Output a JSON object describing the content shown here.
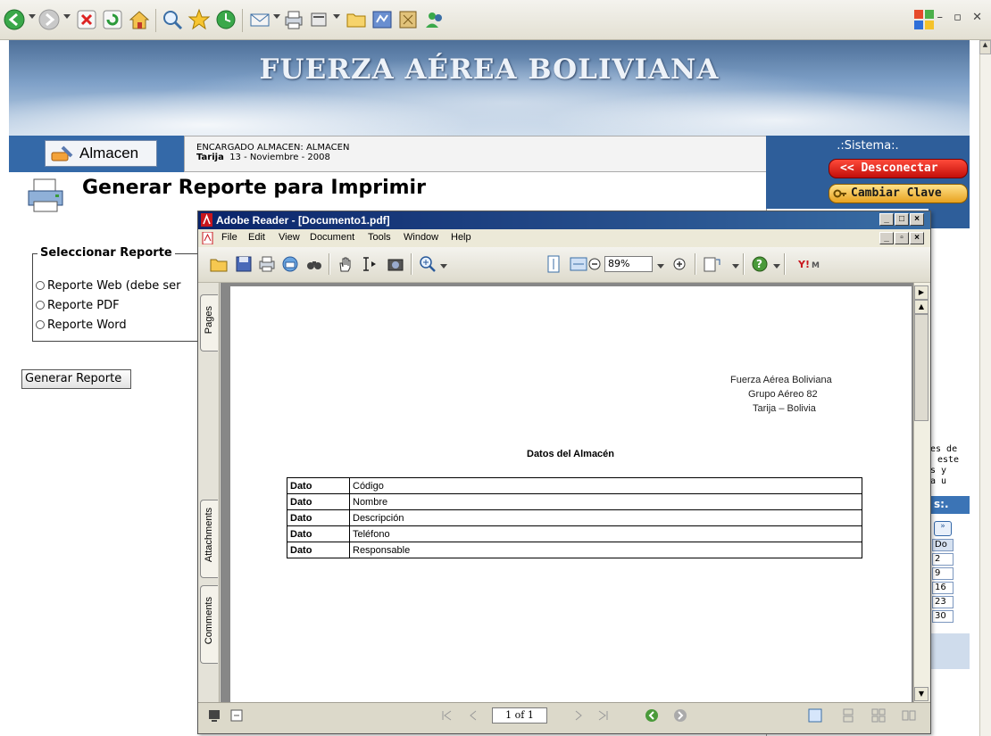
{
  "browser": {
    "toolbar_icons": [
      "back-arrow-icon",
      "forward-arrow-icon",
      "stop-icon",
      "refresh-icon",
      "home-icon",
      "search-icon",
      "favorites-star-icon",
      "history-icon",
      "mail-icon",
      "print-icon",
      "edit-icon",
      "folder-icon",
      "messenger-icon",
      "research-icon",
      "users-icon"
    ],
    "window_controls": "– ▫ ✕"
  },
  "banner": {
    "title": "FUERZA AÉREA BOLIVIANA"
  },
  "header": {
    "almacen_label": "Almacen",
    "encargado": "ENCARGADO ALMACEN: ALMACEN",
    "city": "Tarija",
    "date": "13 - Noviembre - 2008"
  },
  "sistema": {
    "title": ".:Sistema:.",
    "disconnect_label": "<< Desconectar",
    "change_key_label": "Cambiar Clave"
  },
  "right_fragments": {
    "text_lines": [
      "es de",
      "este",
      "s   y",
      "a   u"
    ],
    "section_label": "s:.",
    "cal_next": "»",
    "cal_header": "Do",
    "cal_days": [
      "2",
      "9",
      "16",
      "23",
      "30"
    ]
  },
  "main": {
    "title": "Generar Reporte para Imprimir",
    "fieldset_legend": "Seleccionar Reporte",
    "options": [
      "Reporte Web (debe ser",
      "Reporte PDF",
      "Reporte Word"
    ],
    "generate_button": "Generar Reporte"
  },
  "reader": {
    "title": "Adobe Reader - [Documento1.pdf]",
    "menu": [
      "File",
      "Edit",
      "View",
      "Document",
      "Tools",
      "Window",
      "Help"
    ],
    "zoom": "89%",
    "side_tabs": [
      "Pages",
      "Attachments",
      "Comments"
    ],
    "page_indicator": "1 of 1",
    "document": {
      "header_lines": [
        "Fuerza Aérea Boliviana",
        "Grupo Aéreo 82",
        "Tarija – Bolivia"
      ],
      "section_title": "Datos del Almacén",
      "rows": [
        {
          "label": "Dato",
          "value": "Código"
        },
        {
          "label": "Dato",
          "value": "Nombre"
        },
        {
          "label": "Dato",
          "value": "Descripción"
        },
        {
          "label": "Dato",
          "value": "Teléfono"
        },
        {
          "label": "Dato",
          "value": "Responsable"
        }
      ]
    }
  },
  "colors": {
    "accent_blue": "#2e5e9a",
    "reader_title": "#0a246a",
    "disconnect_red": "#d11a12",
    "change_key_orange": "#f0b030"
  }
}
